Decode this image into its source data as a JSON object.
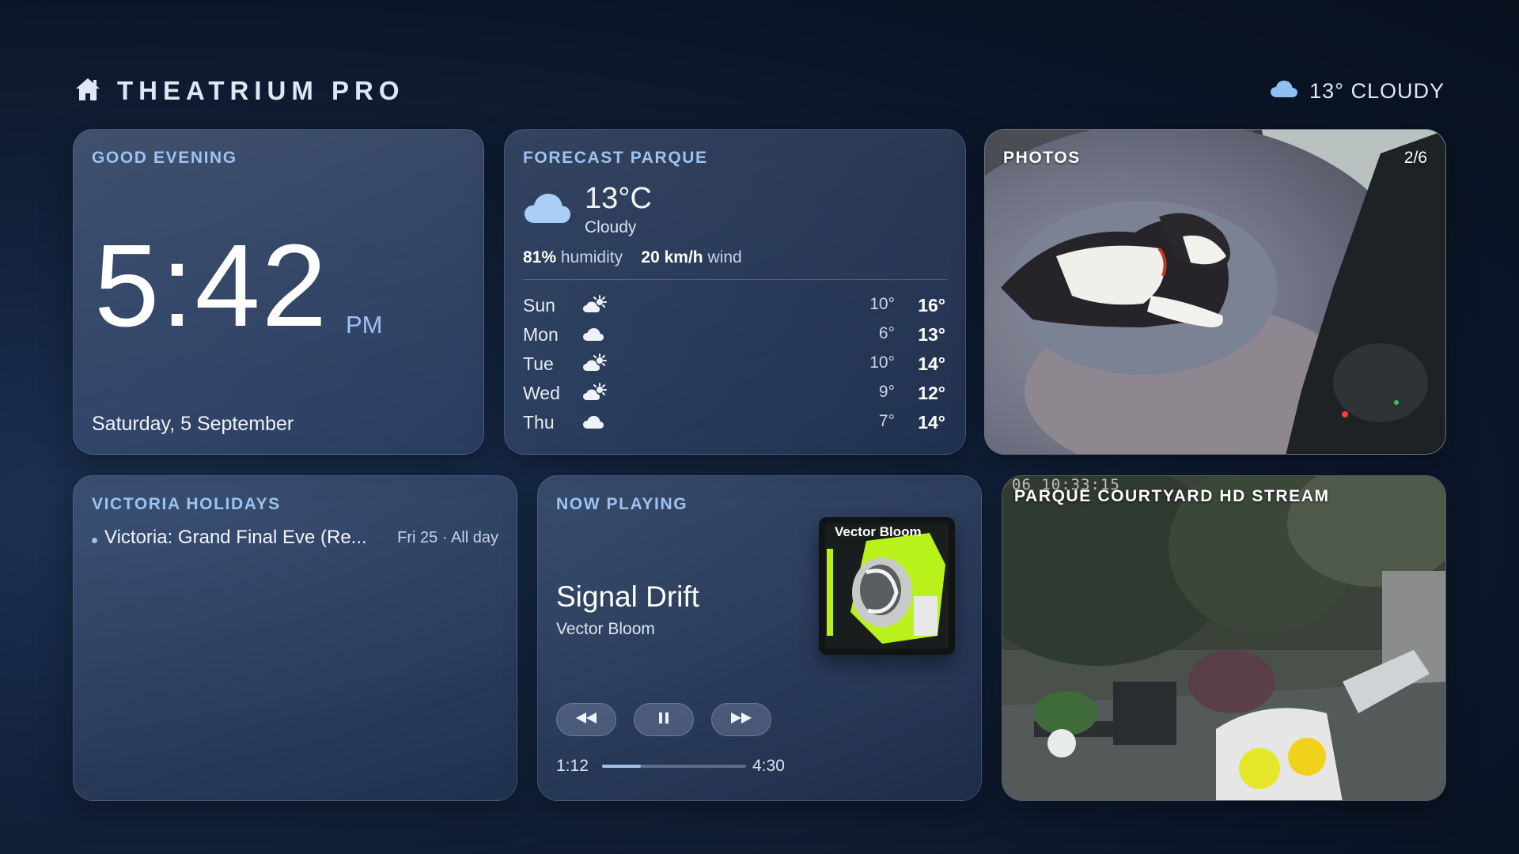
{
  "header": {
    "brand_icon": "home-icon",
    "brand_title": "THEATRIUM PRO",
    "weather_icon": "cloud-icon",
    "weather_text": "13° CLOUDY"
  },
  "clock": {
    "label": "GOOD EVENING",
    "time": "5:42",
    "ampm": "PM",
    "date": "Saturday, 5 September"
  },
  "forecast": {
    "label": "FORECAST PARQUE",
    "icon": "cloud-icon",
    "temp": "13°C",
    "condition": "Cloudy",
    "humidity_value": "81%",
    "humidity_label": "humidity",
    "wind_value": "20 km/h",
    "wind_label": "wind",
    "days": [
      {
        "day": "Sun",
        "icon": "partly-sunny-icon",
        "lo": "10°",
        "hi": "16°"
      },
      {
        "day": "Mon",
        "icon": "cloud-icon",
        "lo": "6°",
        "hi": "13°"
      },
      {
        "day": "Tue",
        "icon": "partly-sunny-icon",
        "lo": "10°",
        "hi": "14°"
      },
      {
        "day": "Wed",
        "icon": "partly-sunny-icon",
        "lo": "9°",
        "hi": "12°"
      },
      {
        "day": "Thu",
        "icon": "cloud-icon",
        "lo": "7°",
        "hi": "14°"
      }
    ]
  },
  "photos": {
    "label": "PHOTOS",
    "count": "2/6"
  },
  "holidays": {
    "label": "VICTORIA HOLIDAYS",
    "items": [
      {
        "name": "Victoria: Grand Final Eve (Re...",
        "when": "Fri 25 · All day"
      }
    ]
  },
  "now_playing": {
    "label": "NOW PLAYING",
    "title": "Signal Drift",
    "artist": "Vector Bloom",
    "album_text": "Vector Bloom",
    "elapsed": "1:12",
    "total": "4:30",
    "progress": 0.267,
    "buttons": [
      "rewind-icon",
      "pause-icon",
      "fast-forward-icon"
    ]
  },
  "stream": {
    "label": "PARQUE COURTYARD HD STREAM",
    "timestamp": "06 10:33:15"
  },
  "colors": {
    "accent": "#9fc2ef",
    "background": "#0f1c33"
  }
}
